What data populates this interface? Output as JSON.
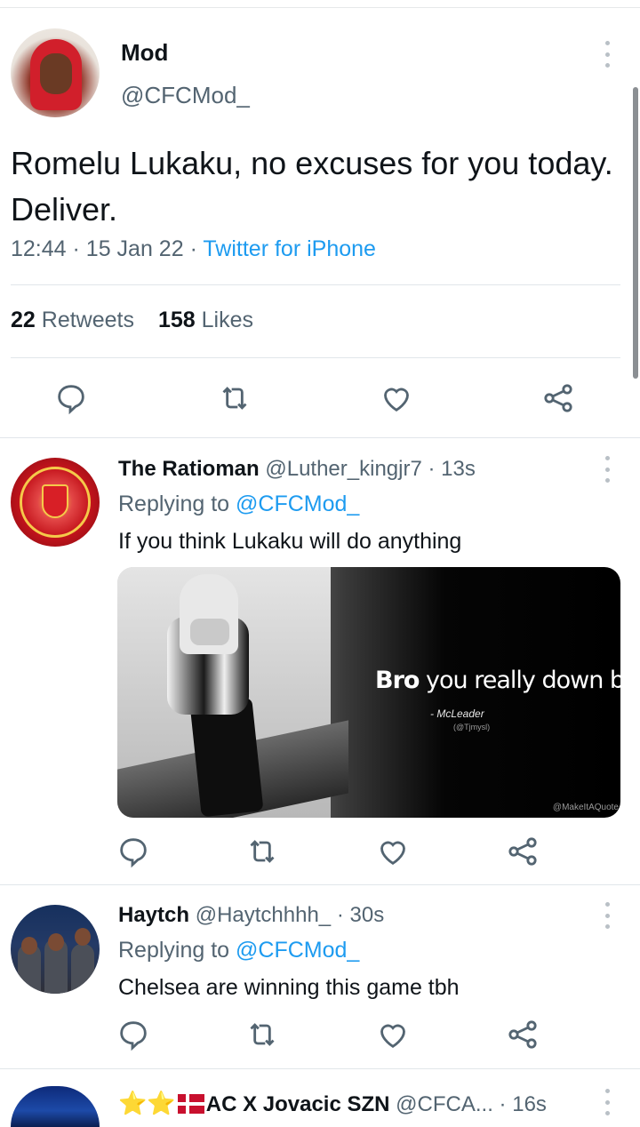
{
  "main_tweet": {
    "name": "Mod",
    "handle": "@CFCMod_",
    "text": "Romelu Lukaku, no excuses for you today. Deliver.",
    "time": "12:44",
    "date": "15 Jan 22",
    "source": "Twitter for iPhone",
    "retweets_count": "22",
    "retweets_label": "Retweets",
    "likes_count": "158",
    "likes_label": "Likes"
  },
  "replies": [
    {
      "name": "The Ratioman",
      "handle": "@Luther_kingjr7",
      "age": "13s",
      "replying_label": "Replying to",
      "replying_to": "@CFCMod_",
      "text": "If you think Lukaku will do anything",
      "media": {
        "caption_bold": "Bro",
        "caption_rest": "you really down bad",
        "author": "- McLeader",
        "author_handle": "(@Tjmysl)",
        "watermark": "@MakeItAQuote"
      }
    },
    {
      "name": "Haytch",
      "handle": "@Haytchhhh_",
      "age": "30s",
      "replying_label": "Replying to",
      "replying_to": "@CFCMod_",
      "text": "Chelsea are winning this game tbh"
    },
    {
      "name_prefix": "⭐⭐",
      "name": "AC X Jovacic SZN",
      "handle": "@CFCA...",
      "age": "16s"
    }
  ],
  "separators": {
    "dot": "·"
  },
  "icons": {
    "reply": "reply-icon",
    "retweet": "retweet-icon",
    "like": "heart-icon",
    "share": "share-icon",
    "more": "more-options-icon"
  },
  "colors": {
    "link": "#1d9bf0",
    "secondary_text": "#536471",
    "icon": "#536471"
  }
}
